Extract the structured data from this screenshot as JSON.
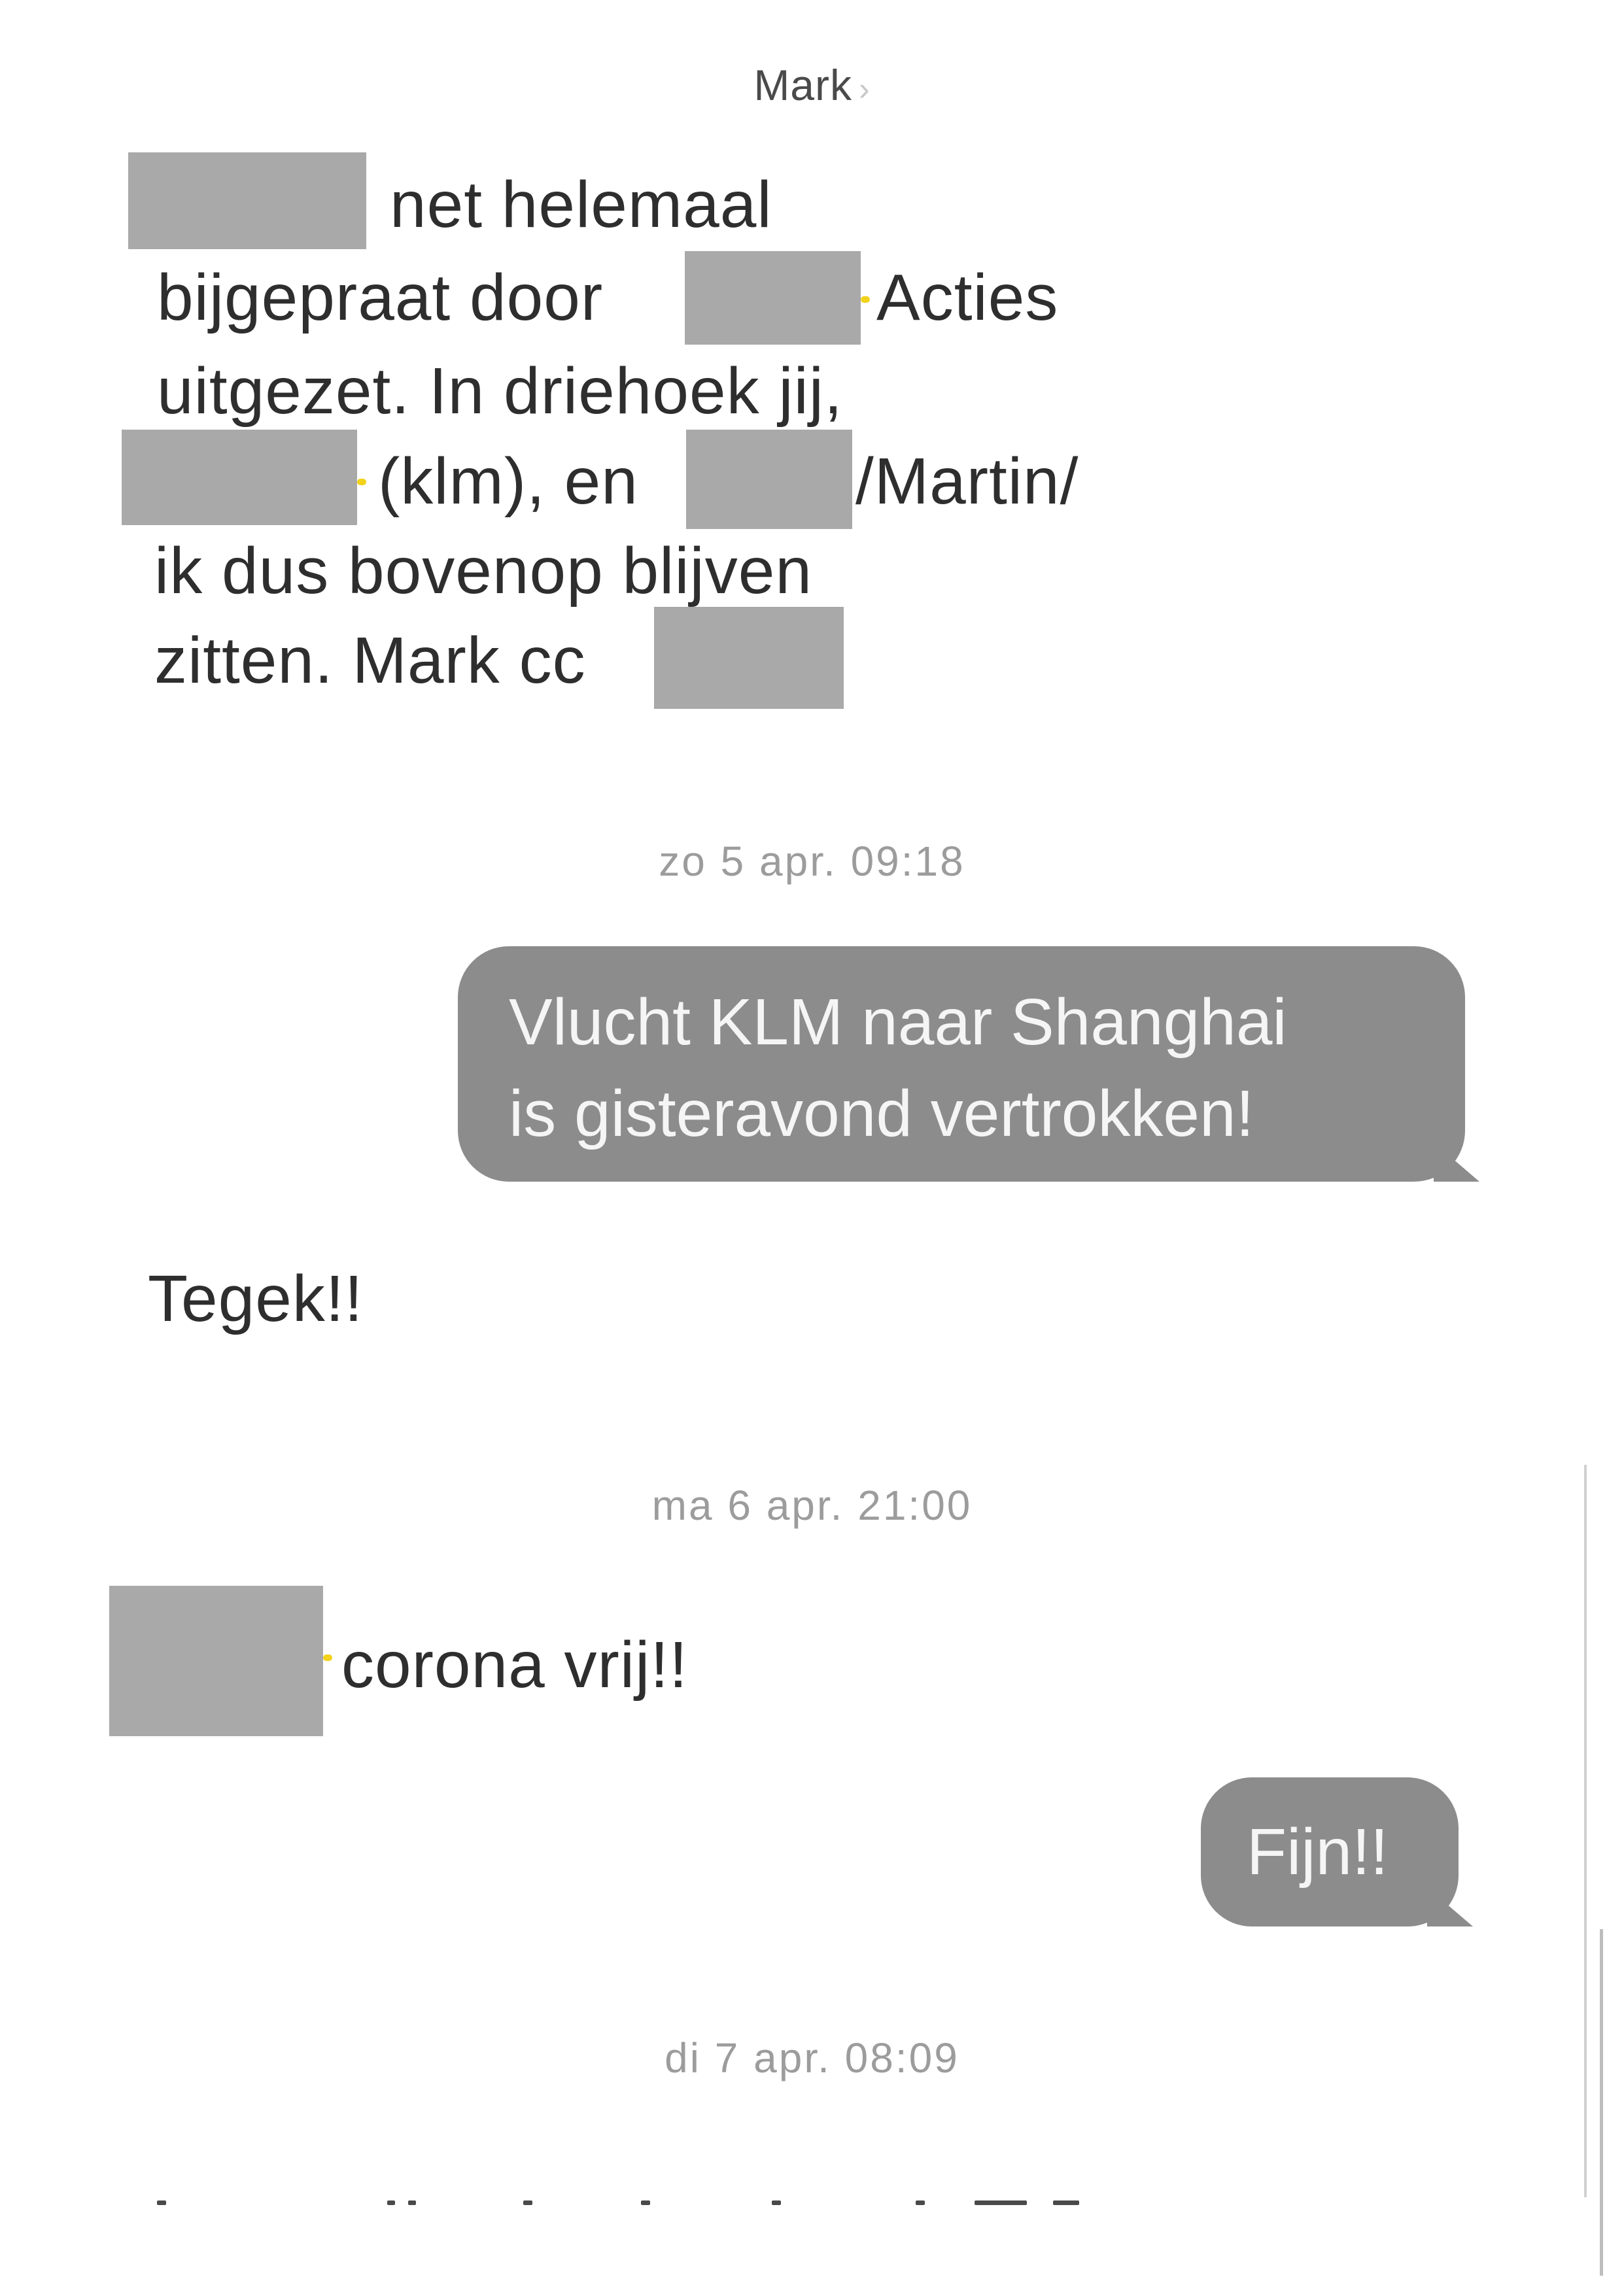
{
  "header": {
    "contact_name": "Mark",
    "chevron": "›"
  },
  "messages": {
    "first": {
      "line1": "net helemaal",
      "line2a": "bijgepraat door",
      "line2b": "Acties",
      "line3": "uitgezet. In driehoek jij,",
      "line4a": "(klm), en",
      "line4b": "/Martin/",
      "line5": "ik dus bovenop blijven",
      "line6": "zitten. Mark cc"
    },
    "timestamp1": "zo 5 apr. 09:18",
    "sent1": {
      "line1": "Vlucht KLM naar Shanghai",
      "line2": "is gisteravond vertrokken!"
    },
    "received2": "Tegek!!",
    "timestamp2": "ma 6 apr. 21:00",
    "received3": "corona vrij!!",
    "sent2": "Fijn!!",
    "timestamp3": "di 7 apr. 08:09"
  },
  "colors": {
    "sent_bubble": "#8c8c8c",
    "redaction": "#a9a9a9",
    "highlight": "#f2d21b"
  }
}
